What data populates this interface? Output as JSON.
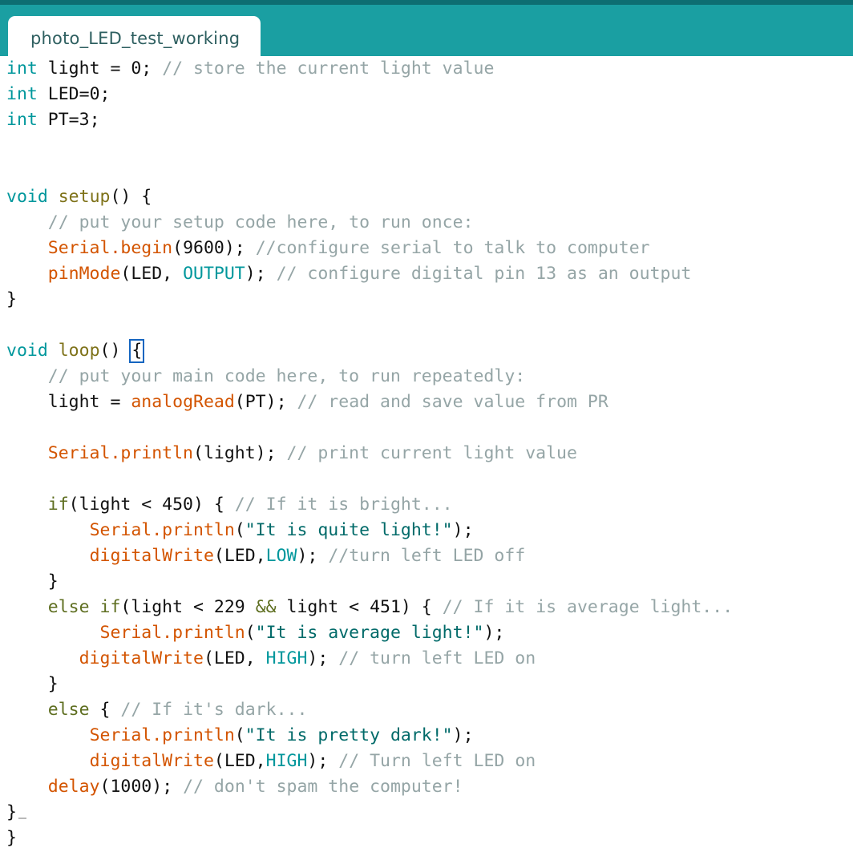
{
  "window": {
    "app": "Arduino IDE",
    "accent_color": "#1a9fa2",
    "accent_dark_color": "#0d6e72",
    "background_color": "#ffffff"
  },
  "tab_bar": {
    "tabs": [
      {
        "label": "photo_LED_test_working",
        "active": true
      }
    ]
  },
  "theme": {
    "type_color": "#00979c",
    "function_color": "#7e7219",
    "keyword_color": "#5e6e20",
    "call_color": "#d35400",
    "string_color": "#006a69",
    "comment_color": "#95a5a6",
    "text_color": "#111111",
    "bracket_match_color": "#1565c0"
  },
  "editor": {
    "language": "arduino-c",
    "bracket_match_char": "{",
    "lines": [
      {
        "n": 1,
        "indent": 0,
        "tokens": [
          {
            "t": "type",
            "v": "int"
          },
          {
            "t": "plain",
            "v": " light = "
          },
          {
            "t": "num",
            "v": "0"
          },
          {
            "t": "plain",
            "v": "; "
          },
          {
            "t": "comment",
            "v": "// store the current light value"
          }
        ]
      },
      {
        "n": 2,
        "indent": 0,
        "tokens": [
          {
            "t": "type",
            "v": "int"
          },
          {
            "t": "plain",
            "v": " LED="
          },
          {
            "t": "num",
            "v": "0"
          },
          {
            "t": "plain",
            "v": ";"
          }
        ]
      },
      {
        "n": 3,
        "indent": 0,
        "tokens": [
          {
            "t": "type",
            "v": "int"
          },
          {
            "t": "plain",
            "v": " PT="
          },
          {
            "t": "num",
            "v": "3"
          },
          {
            "t": "plain",
            "v": ";"
          }
        ]
      },
      {
        "n": 4,
        "indent": 0,
        "tokens": []
      },
      {
        "n": 5,
        "indent": 0,
        "tokens": []
      },
      {
        "n": 6,
        "indent": 0,
        "tokens": [
          {
            "t": "type",
            "v": "void"
          },
          {
            "t": "plain",
            "v": " "
          },
          {
            "t": "fn",
            "v": "setup"
          },
          {
            "t": "plain",
            "v": "() {"
          }
        ]
      },
      {
        "n": 7,
        "indent": 4,
        "tokens": [
          {
            "t": "comment",
            "v": "// put your setup code here, to run once:"
          }
        ]
      },
      {
        "n": 8,
        "indent": 4,
        "tokens": [
          {
            "t": "call",
            "v": "Serial.begin"
          },
          {
            "t": "plain",
            "v": "("
          },
          {
            "t": "num",
            "v": "9600"
          },
          {
            "t": "plain",
            "v": "); "
          },
          {
            "t": "comment",
            "v": "//configure serial to talk to computer"
          }
        ]
      },
      {
        "n": 9,
        "indent": 4,
        "tokens": [
          {
            "t": "call",
            "v": "pinMode"
          },
          {
            "t": "plain",
            "v": "(LED, "
          },
          {
            "t": "type",
            "v": "OUTPUT"
          },
          {
            "t": "plain",
            "v": "); "
          },
          {
            "t": "comment",
            "v": "// configure digital pin 13 as an output"
          }
        ]
      },
      {
        "n": 10,
        "indent": 0,
        "tokens": [
          {
            "t": "plain",
            "v": "}"
          }
        ]
      },
      {
        "n": 11,
        "indent": 0,
        "tokens": []
      },
      {
        "n": 12,
        "indent": 0,
        "tokens": [
          {
            "t": "type",
            "v": "void"
          },
          {
            "t": "plain",
            "v": " "
          },
          {
            "t": "fn",
            "v": "loop"
          },
          {
            "t": "plain",
            "v": "() "
          },
          {
            "t": "bracematch",
            "v": "{"
          }
        ]
      },
      {
        "n": 13,
        "indent": 4,
        "tokens": [
          {
            "t": "comment",
            "v": "// put your main code here, to run repeatedly:"
          }
        ]
      },
      {
        "n": 14,
        "indent": 4,
        "tokens": [
          {
            "t": "plain",
            "v": "light = "
          },
          {
            "t": "call",
            "v": "analogRead"
          },
          {
            "t": "plain",
            "v": "(PT); "
          },
          {
            "t": "comment",
            "v": "// read and save value from PR"
          }
        ]
      },
      {
        "n": 15,
        "indent": 0,
        "tokens": []
      },
      {
        "n": 16,
        "indent": 4,
        "tokens": [
          {
            "t": "call",
            "v": "Serial.println"
          },
          {
            "t": "plain",
            "v": "(light); "
          },
          {
            "t": "comment",
            "v": "// print current light value"
          }
        ]
      },
      {
        "n": 17,
        "indent": 0,
        "tokens": []
      },
      {
        "n": 18,
        "indent": 4,
        "tokens": [
          {
            "t": "kw",
            "v": "if"
          },
          {
            "t": "plain",
            "v": "(light < "
          },
          {
            "t": "num",
            "v": "450"
          },
          {
            "t": "plain",
            "v": ") { "
          },
          {
            "t": "comment",
            "v": "// If it is bright..."
          }
        ]
      },
      {
        "n": 19,
        "indent": 8,
        "tokens": [
          {
            "t": "call",
            "v": "Serial.println"
          },
          {
            "t": "plain",
            "v": "("
          },
          {
            "t": "str",
            "v": "\"It is quite light!\""
          },
          {
            "t": "plain",
            "v": ");"
          }
        ]
      },
      {
        "n": 20,
        "indent": 8,
        "tokens": [
          {
            "t": "call",
            "v": "digitalWrite"
          },
          {
            "t": "plain",
            "v": "(LED,"
          },
          {
            "t": "type",
            "v": "LOW"
          },
          {
            "t": "plain",
            "v": "); "
          },
          {
            "t": "comment",
            "v": "//turn left LED off"
          }
        ]
      },
      {
        "n": 21,
        "indent": 4,
        "tokens": [
          {
            "t": "plain",
            "v": "}"
          }
        ]
      },
      {
        "n": 22,
        "indent": 4,
        "tokens": [
          {
            "t": "kw",
            "v": "else if"
          },
          {
            "t": "plain",
            "v": "(light < "
          },
          {
            "t": "num",
            "v": "229"
          },
          {
            "t": "plain",
            "v": " "
          },
          {
            "t": "kw",
            "v": "&&"
          },
          {
            "t": "plain",
            "v": " light < "
          },
          {
            "t": "num",
            "v": "451"
          },
          {
            "t": "plain",
            "v": ") { "
          },
          {
            "t": "comment",
            "v": "// If it is average light..."
          }
        ]
      },
      {
        "n": 23,
        "indent": 9,
        "tokens": [
          {
            "t": "call",
            "v": "Serial.println"
          },
          {
            "t": "plain",
            "v": "("
          },
          {
            "t": "str",
            "v": "\"It is average light!\""
          },
          {
            "t": "plain",
            "v": ");"
          }
        ]
      },
      {
        "n": 24,
        "indent": 7,
        "tokens": [
          {
            "t": "call",
            "v": "digitalWrite"
          },
          {
            "t": "plain",
            "v": "(LED, "
          },
          {
            "t": "type",
            "v": "HIGH"
          },
          {
            "t": "plain",
            "v": "); "
          },
          {
            "t": "comment",
            "v": "// turn left LED on"
          }
        ]
      },
      {
        "n": 25,
        "indent": 4,
        "tokens": [
          {
            "t": "plain",
            "v": "}"
          }
        ]
      },
      {
        "n": 26,
        "indent": 4,
        "tokens": [
          {
            "t": "kw",
            "v": "else"
          },
          {
            "t": "plain",
            "v": " { "
          },
          {
            "t": "comment",
            "v": "// If it's dark..."
          }
        ]
      },
      {
        "n": 27,
        "indent": 8,
        "tokens": [
          {
            "t": "call",
            "v": "Serial.println"
          },
          {
            "t": "plain",
            "v": "("
          },
          {
            "t": "str",
            "v": "\"It is pretty dark!\""
          },
          {
            "t": "plain",
            "v": ");"
          }
        ]
      },
      {
        "n": 28,
        "indent": 8,
        "tokens": [
          {
            "t": "call",
            "v": "digitalWrite"
          },
          {
            "t": "plain",
            "v": "(LED,"
          },
          {
            "t": "type",
            "v": "HIGH"
          },
          {
            "t": "plain",
            "v": "); "
          },
          {
            "t": "comment",
            "v": "// Turn left LED on"
          }
        ]
      },
      {
        "n": 29,
        "indent": 4,
        "tokens": [
          {
            "t": "call",
            "v": "delay"
          },
          {
            "t": "plain",
            "v": "("
          },
          {
            "t": "num",
            "v": "1000"
          },
          {
            "t": "plain",
            "v": "); "
          },
          {
            "t": "comment",
            "v": "// don't spam the computer!"
          }
        ]
      },
      {
        "n": 30,
        "indent": 0,
        "tokens": [
          {
            "t": "plain",
            "v": "}"
          },
          {
            "t": "caret",
            "v": ""
          }
        ]
      },
      {
        "n": 31,
        "indent": 0,
        "tokens": [
          {
            "t": "plain",
            "v": "}"
          }
        ]
      }
    ]
  }
}
